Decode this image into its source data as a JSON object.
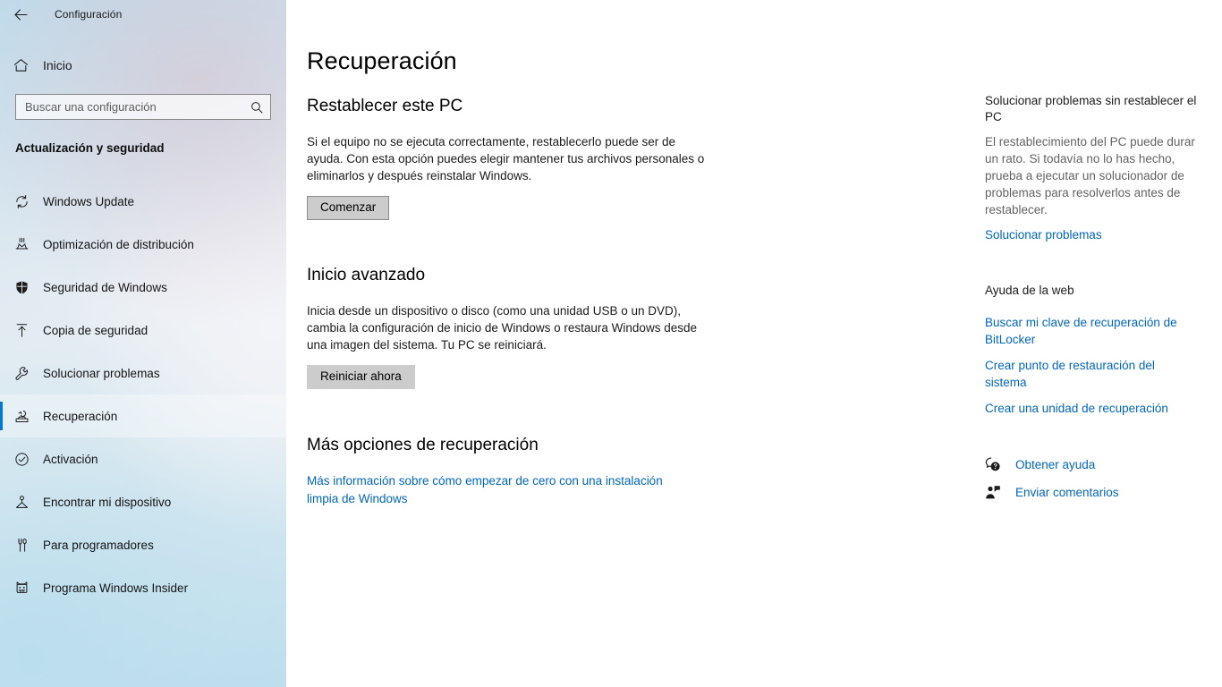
{
  "window": {
    "title": "Configuración",
    "back_icon": "back-arrow-icon",
    "minimize_label": "─",
    "maximize_label": "❐",
    "close_label": "✕"
  },
  "sidebar": {
    "home_label": "Inicio",
    "home_icon": "home-icon",
    "search": {
      "placeholder": "Buscar una configuración",
      "value": "",
      "icon": "search-icon"
    },
    "category_header": "Actualización y seguridad",
    "accent_color": "#0078d4",
    "items": [
      {
        "label": "Windows Update",
        "icon": "refresh-icon",
        "selected": false
      },
      {
        "label": "Optimización de distribución",
        "icon": "delivery-optimization-icon",
        "selected": false
      },
      {
        "label": "Seguridad de Windows",
        "icon": "shield-icon",
        "selected": false
      },
      {
        "label": "Copia de seguridad",
        "icon": "backup-upload-icon",
        "selected": false
      },
      {
        "label": "Solucionar problemas",
        "icon": "wrench-icon",
        "selected": false
      },
      {
        "label": "Recuperación",
        "icon": "recovery-icon",
        "selected": true
      },
      {
        "label": "Activación",
        "icon": "check-circle-icon",
        "selected": false
      },
      {
        "label": "Encontrar mi dispositivo",
        "icon": "find-my-device-icon",
        "selected": false
      },
      {
        "label": "Para programadores",
        "icon": "developer-tools-icon",
        "selected": false
      },
      {
        "label": "Programa Windows Insider",
        "icon": "insider-cat-icon",
        "selected": false
      }
    ]
  },
  "main": {
    "page_title": "Recuperación",
    "sections": [
      {
        "heading": "Restablecer este PC",
        "body": "Si el equipo no se ejecuta correctamente, restablecerlo puede ser de ayuda. Con esta opción puedes elegir mantener tus archivos personales o eliminarlos y después reinstalar Windows.",
        "button": "Comenzar"
      },
      {
        "heading": "Inicio avanzado",
        "body": "Inicia desde un dispositivo o disco (como una unidad USB o un DVD), cambia la configuración de inicio de Windows o restaura Windows desde una imagen del sistema. Tu PC se reiniciará.",
        "button": "Reiniciar ahora"
      },
      {
        "heading": "Más opciones de recuperación",
        "link": "Más información sobre cómo empezar de cero con una instalación limpia de Windows"
      }
    ]
  },
  "rail": {
    "troubleshoot": {
      "heading": "Solucionar problemas sin restablecer el PC",
      "body": "El restablecimiento del PC puede durar un rato. Si todavía no lo has hecho, prueba a ejecutar un solucionador de problemas para resolverlos antes de restablecer.",
      "link": "Solucionar problemas"
    },
    "web_help": {
      "heading": "Ayuda de la web",
      "links": [
        "Buscar mi clave de recuperación de BitLocker",
        "Crear punto de restauración del sistema",
        "Crear una unidad de recuperación"
      ]
    },
    "support": [
      {
        "label": "Obtener ayuda",
        "icon": "question-bubble-icon"
      },
      {
        "label": "Enviar comentarios",
        "icon": "feedback-person-icon"
      }
    ]
  }
}
